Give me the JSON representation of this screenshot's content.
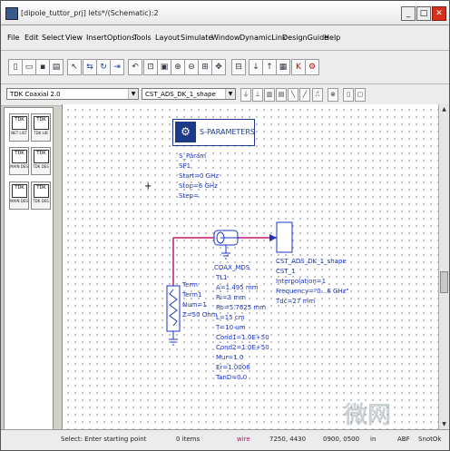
{
  "window": {
    "title": "[dipole_tuttor_prj] lets*/(Schematic):2",
    "buttons": {
      "minimize": "_",
      "maximize": "□",
      "close": "✕"
    }
  },
  "menu": [
    "File",
    "Edit",
    "Select",
    "View",
    "Insert",
    "Options",
    "Tools",
    "Layout",
    "Simulate",
    "Window",
    "DynamicLink",
    "DesignGuide",
    "Help"
  ],
  "toolbar2": {
    "palette_select": "TDK Coaxial 2.0",
    "component_select": "CST_ADS_DK_1_shape"
  },
  "palette_items": [
    {
      "icon": "TDK",
      "label": "NET LIST"
    },
    {
      "icon": "TDK",
      "label": "TDK LIB"
    },
    {
      "icon": "TDK",
      "label": "MAIN DES"
    },
    {
      "icon": "TDK",
      "label": "TDK DES"
    },
    {
      "icon": "TDK",
      "label": "MAIN DES"
    },
    {
      "icon": "TDK",
      "label": "TDK DES"
    }
  ],
  "schematic": {
    "sparam_block": {
      "title": "S-PARAMETERS",
      "lines": [
        "S_Param",
        "SP1",
        "Start=0 GHz",
        "Stop=6 GHz",
        "Step="
      ]
    },
    "coax_label": "COAX_MDS",
    "coax_lines": [
      "TL1",
      "A=1.495 mm",
      "Ri=3 mm",
      "Ro=5.7625 mm",
      "L=15 cm",
      "T=10 um",
      "Cond1=1.0E+50",
      "Cond2=1.0E+50",
      "Mur=1.0",
      "Er=1.0006",
      "TanD=0.0"
    ],
    "term_lines": [
      "Term",
      "Term1",
      "Num=1",
      "Z=50 Ohm"
    ],
    "cst_lines": [
      "CST_ADS_DK_1_shape",
      "CST_1",
      "Interpolation=1",
      "Frequency=\"0...6 GHz\"",
      "Tdc=27 mm"
    ]
  },
  "status": {
    "message": "Select: Enter starting point",
    "items": "0 items",
    "mode": "wire",
    "coords": "7250, 4430",
    "delta": "0900, 0500",
    "unit": "in",
    "cmd": "ABF",
    "extra": "SnotOk"
  },
  "watermark": "微网",
  "colors": {
    "component_blue": "#1a33c8",
    "wire": "#c0186f",
    "accent": "#1d3a8a"
  }
}
